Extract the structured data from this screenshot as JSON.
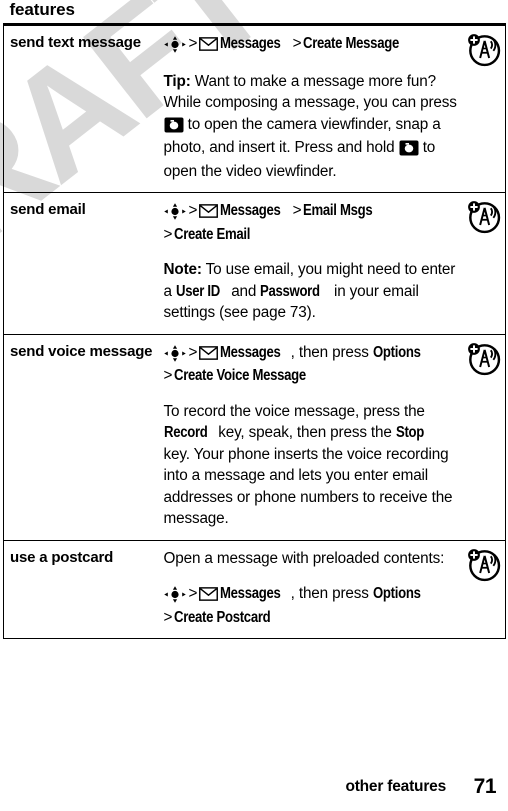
{
  "document": {
    "table_header": "features",
    "watermark_text": "DRAFT",
    "watermark_color": "#d9d9d9"
  },
  "icons": {
    "nav_key": "navigation-key-icon",
    "envelope": "envelope-icon",
    "camera": "camera-key-icon",
    "network_badge": "network-required-icon"
  },
  "rows": [
    {
      "label": "send text message",
      "path": {
        "nav": "nav-key",
        "sep1": ">",
        "envelope": "envelope",
        "menu1": "Messages",
        "sep2": ">",
        "menu2": "Create Message"
      },
      "note_label": "Tip:",
      "note_parts": [
        {
          "type": "text",
          "value": " Want to make a message more fun? While composing a message, you can press "
        },
        {
          "type": "icon",
          "value": "camera"
        },
        {
          "type": "text",
          "value": " to open the camera viewfinder, snap a photo, and insert it. Press and hold "
        },
        {
          "type": "icon",
          "value": "camera"
        },
        {
          "type": "text",
          "value": " to open the video viewfinder."
        }
      ]
    },
    {
      "label": "send email",
      "path": {
        "nav": "nav-key",
        "sep1": ">",
        "envelope": "envelope",
        "menu1": "Messages",
        "sep2": ">",
        "menu2": "Email Msgs",
        "sep3": ">",
        "menu3": "Create Email"
      },
      "note_label": "Note:",
      "note_parts": [
        {
          "type": "text",
          "value": " To use email, you might need to enter a "
        },
        {
          "type": "menu",
          "value": "User ID"
        },
        {
          "type": "text",
          "value": " and "
        },
        {
          "type": "menu",
          "value": "Password"
        },
        {
          "type": "text",
          "value": " in your email settings (see page 73)."
        }
      ]
    },
    {
      "label": "send voice message",
      "path": {
        "nav": "nav-key",
        "sep1": ">",
        "envelope": "envelope",
        "menu1": "Messages",
        "then": ", then press ",
        "menu2": "Options",
        "sep2": ">",
        "menu3": "Create Voice Message"
      },
      "note_label": "",
      "note_parts": [
        {
          "type": "text",
          "value": "To record the voice message, press the "
        },
        {
          "type": "menu",
          "value": "Record"
        },
        {
          "type": "text",
          "value": " key, speak, then press the "
        },
        {
          "type": "menu",
          "value": "Stop"
        },
        {
          "type": "text",
          "value": " key. Your phone inserts the voice recording into a message and lets you enter email addresses or phone numbers to receive the message."
        }
      ]
    },
    {
      "label": "use a postcard",
      "intro": "Open a message with preloaded contents:",
      "path": {
        "nav": "nav-key",
        "sep1": ">",
        "envelope": "envelope",
        "menu1": "Messages",
        "then": ", then press ",
        "menu2": "Options",
        "sep2": ">",
        "menu3": "Create Postcard"
      }
    }
  ],
  "footer": {
    "section": "other features",
    "page_number": "71"
  }
}
